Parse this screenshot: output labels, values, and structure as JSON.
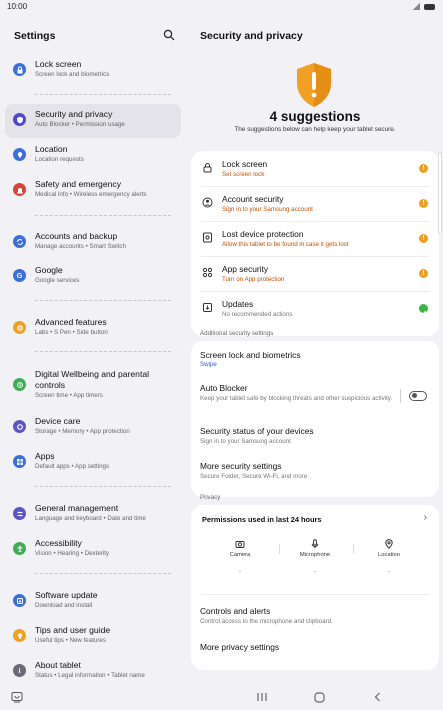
{
  "status": {
    "time": "10:00"
  },
  "left": {
    "title": "Settings",
    "items": [
      {
        "label": "Lock screen",
        "sub": "Screen lock and biometrics"
      },
      {
        "label": "Security and privacy",
        "sub": "Auto Blocker  •  Permission usage"
      },
      {
        "label": "Location",
        "sub": "Location requests"
      },
      {
        "label": "Safety and emergency",
        "sub": "Medical info  •  Wireless emergency alerts"
      },
      {
        "label": "Accounts and backup",
        "sub": "Manage accounts  •  Smart Switch"
      },
      {
        "label": "Google",
        "sub": "Google services"
      },
      {
        "label": "Advanced features",
        "sub": "Labs  •  S Pen  •  Side button"
      },
      {
        "label": "Digital Wellbeing and parental controls",
        "sub": "Screen time  •  App timers"
      },
      {
        "label": "Device care",
        "sub": "Storage  •  Memory  •  App protection"
      },
      {
        "label": "Apps",
        "sub": "Default apps  •  App settings"
      },
      {
        "label": "General management",
        "sub": "Language and keyboard  •  Date and time"
      },
      {
        "label": "Accessibility",
        "sub": "Vision  •  Hearing  •  Dexterity"
      },
      {
        "label": "Software update",
        "sub": "Download and install"
      },
      {
        "label": "Tips and user guide",
        "sub": "Useful tips  •  New features"
      },
      {
        "label": "About tablet",
        "sub": "Status  •  Legal information  •  Tablet name"
      }
    ]
  },
  "right": {
    "title": "Security and privacy",
    "suggestions_title": "4 suggestions",
    "suggestions_sub": "The suggestions below can help keep your tablet secure.",
    "card1": [
      {
        "label": "Lock screen",
        "sub": "Set screen lock"
      },
      {
        "label": "Account security",
        "sub": "Sign in to your Samsung account"
      },
      {
        "label": "Lost device protection",
        "sub": "Allow this tablet to be found in case it gets lost"
      },
      {
        "label": "App security",
        "sub": "Turn on App protection"
      },
      {
        "label": "Updates",
        "sub": "No recommended actions"
      }
    ],
    "additional_header": "Additional security settings",
    "card2": [
      {
        "label": "Screen lock and biometrics",
        "sub": "Swipe"
      },
      {
        "label": "Auto Blocker",
        "sub": "Keep your tablet safe by blocking threats and other suspicious activity."
      },
      {
        "label": "Security status of your devices",
        "sub": "Sign in to your Samsung account"
      },
      {
        "label": "More security settings",
        "sub": "Secure Folder, Secure Wi-Fi, and more"
      }
    ],
    "privacy_header": "Privacy",
    "permissions": {
      "title": "Permissions used in last 24 hours",
      "cols": [
        {
          "label": "Camera",
          "value": "-"
        },
        {
          "label": "Microphone",
          "value": "-"
        },
        {
          "label": "Location",
          "value": "-"
        }
      ]
    },
    "controls": {
      "label": "Controls and alerts",
      "sub": "Control access to the microphone and clipboard."
    },
    "more_privacy": "More privacy settings"
  },
  "colors": {
    "accent_orange": "#f0a020",
    "ok_green": "#3bb54a",
    "selected_bg": "#e4e3e9"
  }
}
